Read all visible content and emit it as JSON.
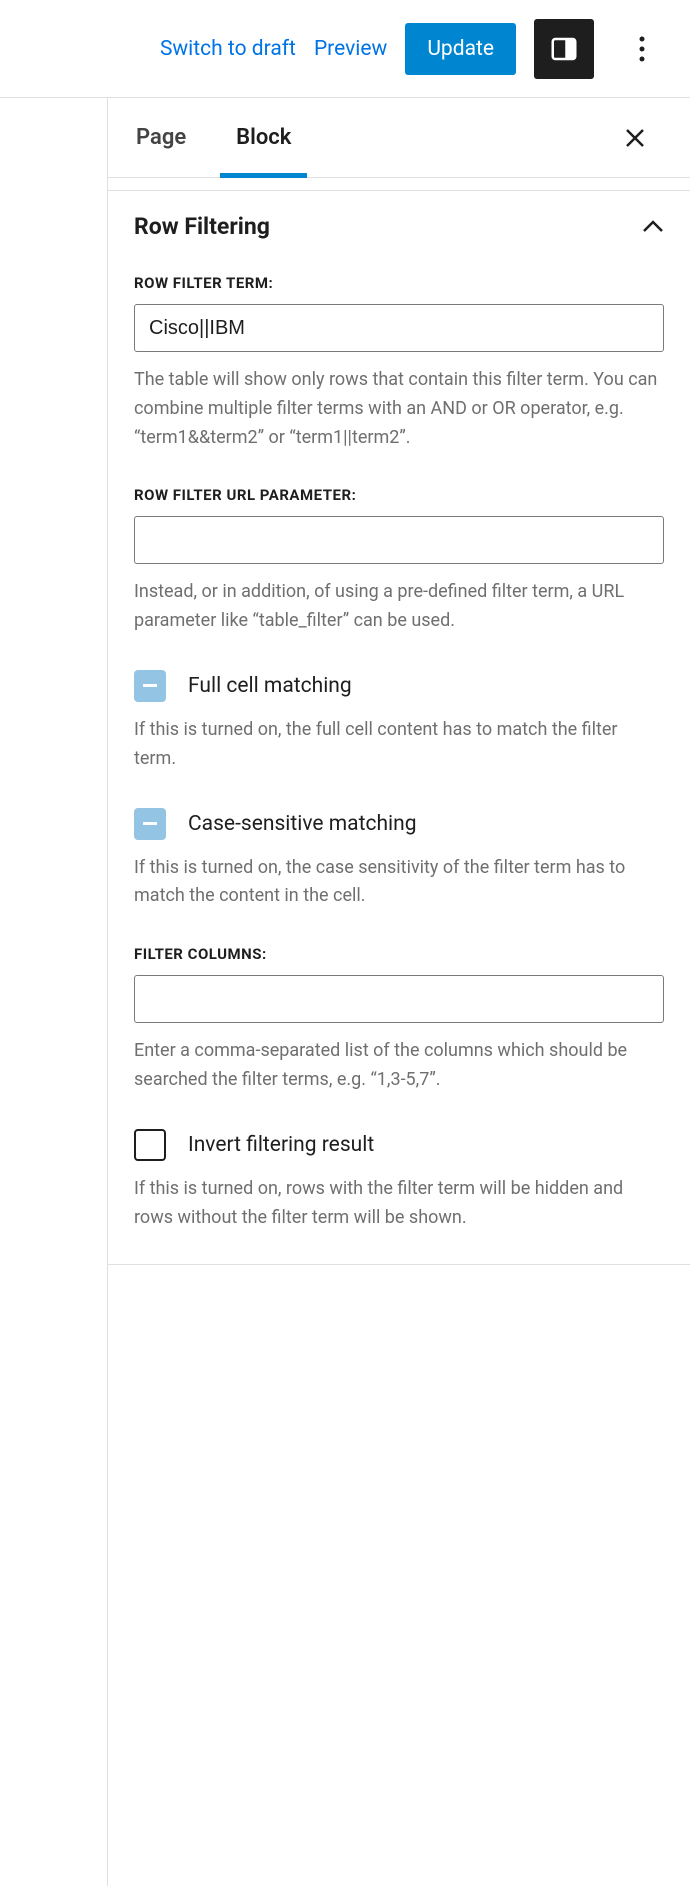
{
  "topbar": {
    "switch_draft": "Switch to draft",
    "preview": "Preview",
    "update": "Update"
  },
  "tabs": {
    "page": "Page",
    "block": "Block",
    "active": "block"
  },
  "section": {
    "title": "Row Filtering"
  },
  "fields": {
    "filter_term": {
      "label": "ROW FILTER TERM:",
      "value": "Cisco||IBM",
      "help": "The table will show only rows that contain this filter term. You can combine multiple filter terms with an AND or OR operator, e.g. “term1&&term2” or “term1||term2”."
    },
    "url_param": {
      "label": "ROW FILTER URL PARAMETER:",
      "value": "",
      "help": "Instead, or in addition, of using a pre-defined filter term, a URL parameter like “table_filter” can be used."
    },
    "full_cell": {
      "label": "Full cell matching",
      "help": "If this is turned on, the full cell content has to match the filter term.",
      "state": "indeterminate"
    },
    "case_sensitive": {
      "label": "Case-sensitive matching",
      "help": "If this is turned on, the case sensitivity of the filter term has to match the content in the cell.",
      "state": "indeterminate"
    },
    "filter_columns": {
      "label": "FILTER COLUMNS:",
      "value": "",
      "help": "Enter a comma-separated list of the columns which should be searched the filter terms, e.g. “1,3-5,7”."
    },
    "invert": {
      "label": "Invert filtering result",
      "help": "If this is turned on, rows with the filter term will be hidden and rows without the filter term will be shown.",
      "state": "off"
    }
  }
}
